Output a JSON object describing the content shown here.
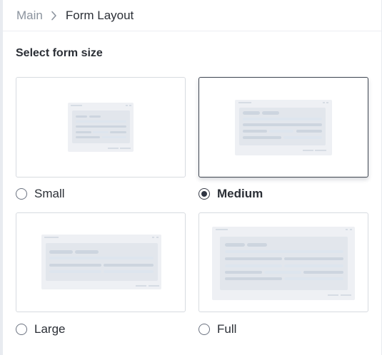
{
  "breadcrumb": {
    "root": "Main",
    "current": "Form Layout"
  },
  "section_title": "Select form size",
  "colors": {
    "border": "#d7dbe0",
    "selected_border": "#3f4651",
    "preview_frame": "#eef0f4",
    "preview_bar_dark": "#cdd5df",
    "preview_bar_light": "#dde5ee",
    "text": "#2b2f36",
    "muted": "#8b939e"
  },
  "options": [
    {
      "label": "Small",
      "checked": false
    },
    {
      "label": "Medium",
      "checked": true
    },
    {
      "label": "Large",
      "checked": false
    },
    {
      "label": "Full",
      "checked": false
    }
  ]
}
